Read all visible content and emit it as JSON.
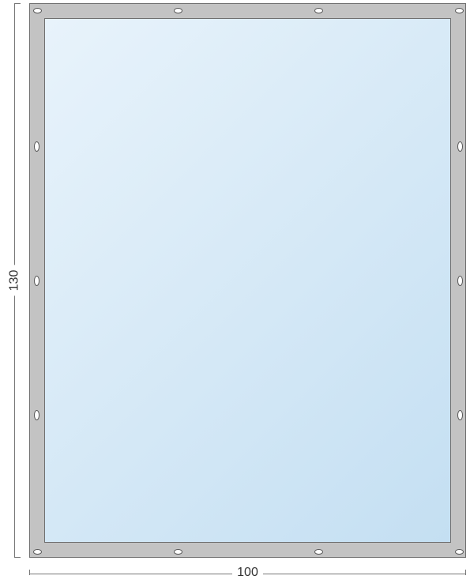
{
  "dimensions": {
    "width_label": "100",
    "height_label": "130"
  },
  "frame_color": "#c3c3c3",
  "panel_gradient_from": "#e8f3fb",
  "panel_gradient_to": "#c4dff2",
  "eyelets": {
    "top": [
      "top-1",
      "top-2",
      "top-3",
      "top-4"
    ],
    "bottom": [
      "bot-1",
      "bot-2",
      "bot-3",
      "bot-4"
    ],
    "left": [
      "left-1",
      "left-2",
      "left-3"
    ],
    "right": [
      "right-1",
      "right-2",
      "right-3"
    ]
  }
}
